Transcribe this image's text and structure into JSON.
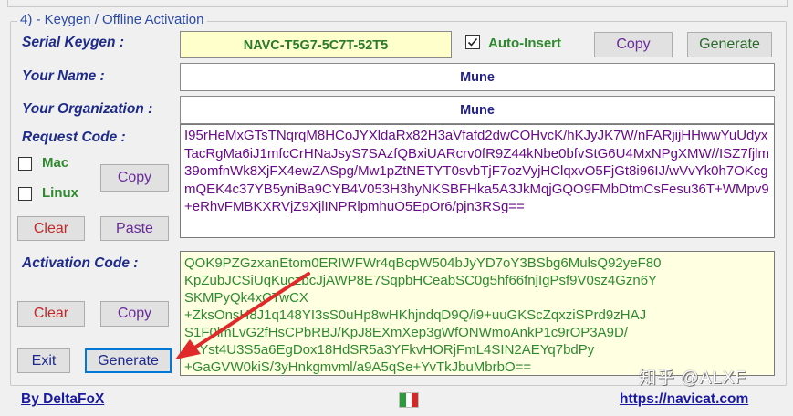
{
  "group": {
    "title": "4) - Keygen / Offline Activation"
  },
  "serial": {
    "label": "Serial Keygen :",
    "value": "NAVC-T5G7-5C7T-52T5",
    "auto_insert_label": "Auto-Insert",
    "auto_insert_checked": true,
    "copy_label": "Copy",
    "generate_label": "Generate"
  },
  "name": {
    "label": "Your Name :",
    "value": "Mune"
  },
  "org": {
    "label": "Your Organization :",
    "value": "Mune"
  },
  "request": {
    "label": "Request Code :",
    "mac_label": "Mac",
    "linux_label": "Linux",
    "copy_label": "Copy",
    "clear_label": "Clear",
    "paste_label": "Paste",
    "text": "I95rHeMxGTsTNqrqM8HCoJYXldaRx82H3aVfafd2dwCOHvcK/hKJyJK7W/nFARjijHHwwYuUdyxTacRgMa6iJ1mfcCrHNaJsyS7SAzfQBxiUARcrv0fR9Z44kNbe0bfvStG6U4MxNPgXMW//ISZ7fjlm39omfnWk8XjFX4ewZASpg/Mw1pZtNETYT0svbTjF7ozVyjHClqxvO5FjGt8i96IJ/wVvYk0h7OKcgmQEK4c37YB5yniBa9CYB4V053H3hyNKSBFHka5A3JkMqjGQO9FMbDtmCsFesu36T+WMpv9+eRhvFMBKXRVjZ9XjlINPRlpmhuO5EpOr6/pjn3RSg=="
  },
  "activation": {
    "label": "Activation Code :",
    "clear_label": "Clear",
    "copy_label": "Copy",
    "lines": [
      "QOK9PZGzxanEtom0ERIWFWr4qBcpW504bJyYD7oY3BSbg6MulsQ92yeF80",
      "KpZubJCSiUqKuczbcJjAWP8E7SqpbHCeabSC0g5hf66fnjIgPsf9V0sz4Gzn6Y",
      "SKMPyQk4xCTwCX",
      "+ZksOnsH8J1q148YI3sS0uHp8wHKhjndqD9Q/i9+uuGKScZqxziSPrd9zHAJ",
      "S1F0lmLvG2fHsCPbRBJ/KpJ8EXmXep3gWfONWmoAnkP1c9rOP3A9D/",
      "+xYst4U3S5a6EgDox18HdSR5a3YFkvHORjFmL4SIN2AEYq7bdPy",
      "+GaGVW0kiS/3yHnkgmvml/a9A5qSe+YvTkJbuMbrbO=="
    ]
  },
  "exit_label": "Exit",
  "generate_label": "Generate",
  "footer": {
    "credit": "By DeltaFoX",
    "url": "https://navicat.com",
    "watermark": "知乎 @ALXF"
  },
  "colors": {
    "label": "#1e2b8a",
    "serial_field_bg": "#ffffcc",
    "request_text": "#6a0a8a",
    "activation_text": "#2e8a2e",
    "activation_bg": "#ffffe1",
    "clear_text": "#c0282a",
    "paste_text": "#6a2a9a",
    "copy_text": "#6a2a9a",
    "generate_text": "#2a6a2a",
    "arrow": "#e02a2a"
  },
  "icons": {
    "flag": "italy-flag-icon"
  }
}
